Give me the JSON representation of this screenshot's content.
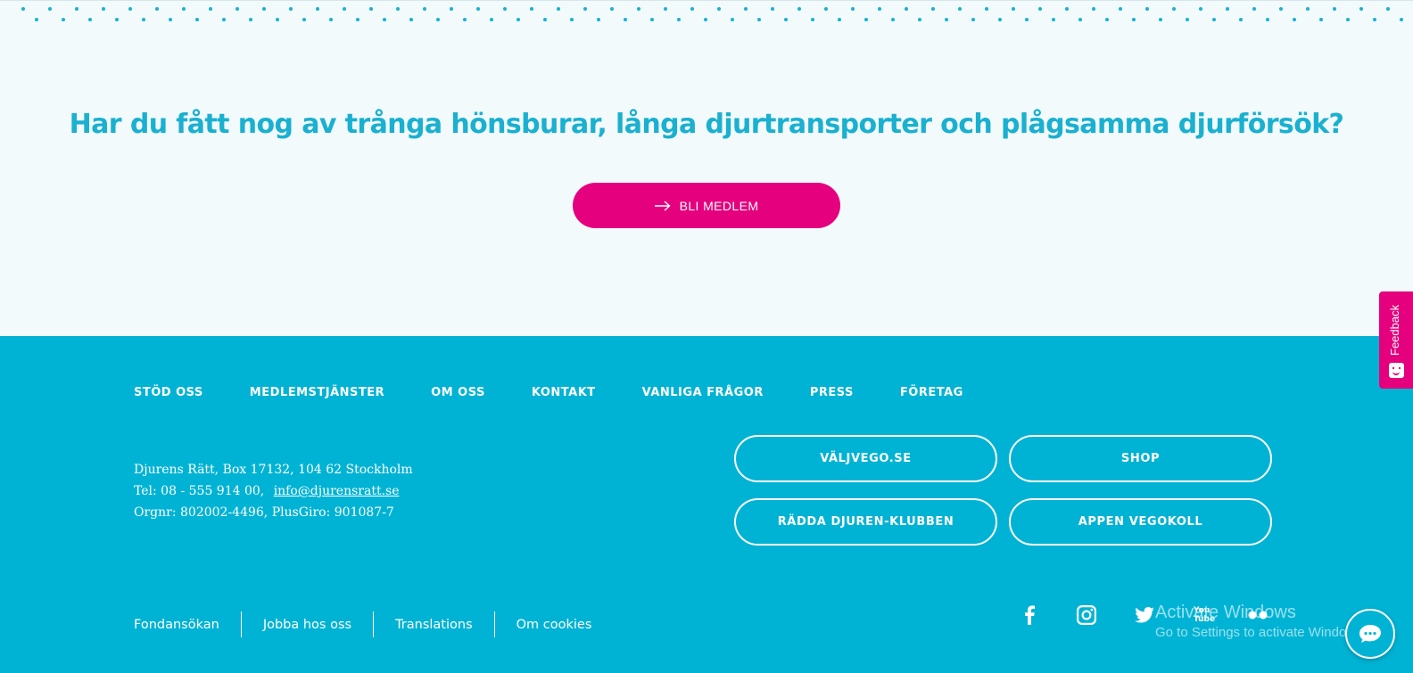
{
  "promo": {
    "title": "Har du fått nog av trånga hönsburar, långa djurtransporter och plågsamma djurförsök?",
    "cta_label": "BLI MEDLEM",
    "cta_icon": "arrow-right-icon"
  },
  "footer": {
    "nav": [
      {
        "label": "STÖD OSS"
      },
      {
        "label": "MEDLEMSTJÄNSTER"
      },
      {
        "label": "OM OSS"
      },
      {
        "label": "KONTAKT"
      },
      {
        "label": "VANLIGA FRÅGOR"
      },
      {
        "label": "PRESS"
      },
      {
        "label": "FÖRETAG"
      }
    ],
    "address_line": "Djurens Rätt, Box 17132, 104 62 Stockholm",
    "phone": "Tel: 08 - 555 914 00,",
    "email": "info@djurensratt.se",
    "org_line": "Orgnr: 802002-4496, PlusGiro: 901087-7",
    "pills": [
      {
        "label": "VÄLJVEGO.SE"
      },
      {
        "label": "SHOP"
      },
      {
        "label": "RÄDDA DJUREN-KLUBBEN"
      },
      {
        "label": "APPEN VEGOKOLL"
      }
    ],
    "bottom_links": [
      {
        "label": "Fondansökan"
      },
      {
        "label": "Jobba hos oss"
      },
      {
        "label": "Translations"
      },
      {
        "label": "Om cookies"
      }
    ],
    "social_icons": [
      "facebook-icon",
      "instagram-icon",
      "twitter-icon",
      "youtube-icon",
      "flickr-icon"
    ],
    "youtube_text": "You Tube"
  },
  "watermark": {
    "line1": "Activate Windows",
    "line2": "Go to Settings to activate Windows."
  },
  "feedback": {
    "label": "Feedback"
  },
  "colors": {
    "accent_pink": "#e5007e",
    "brand_blue": "#00b3d4",
    "title_blue": "#1ab0d0",
    "background": "#f2fafc"
  }
}
